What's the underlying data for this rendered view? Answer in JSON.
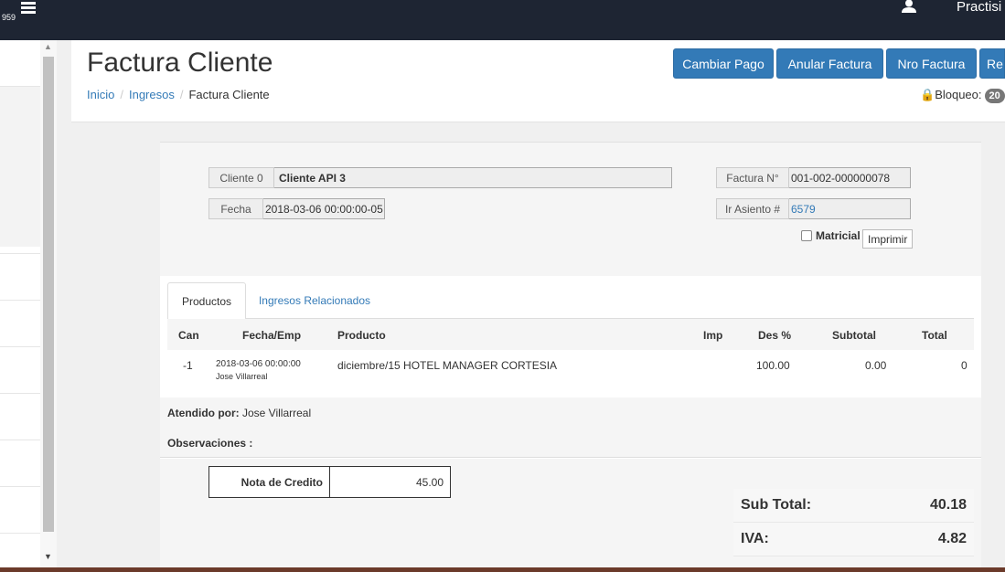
{
  "topbar": {
    "badge": "959",
    "user_name": "Practisi"
  },
  "header": {
    "title": "Factura Cliente",
    "breadcrumb": [
      "Inicio",
      "Ingresos",
      "Factura Cliente"
    ],
    "buttons": {
      "cambiar_pago": "Cambiar Pago",
      "anular_factura": "Anular Factura",
      "nro_factura": "Nro Factura",
      "re": "Re"
    },
    "lock": {
      "label": "Bloqueo:",
      "value": "20"
    }
  },
  "invoice": {
    "cliente_label": "Cliente 0",
    "cliente_value": "Cliente API 3",
    "fecha_label": "Fecha",
    "fecha_value": "2018-03-06 00:00:00-05",
    "factura_label": "Factura N°",
    "factura_value": "001-002-000000078",
    "asiento_label": "Ir Asiento #",
    "asiento_value": "6579",
    "matricial_label": "Matricial",
    "imprimir_label": "Imprimir"
  },
  "tabs": [
    "Productos",
    "Ingresos Relacionados"
  ],
  "table": {
    "headers": [
      "Can",
      "Fecha/Emp",
      "Producto",
      "Imp",
      "Des %",
      "Subtotal",
      "Total"
    ],
    "rows": [
      {
        "can": "-1",
        "fecha": "2018-03-06 00:00:00",
        "emp": "Jose Villarreal",
        "producto": "diciembre/15 HOTEL MANAGER CORTESIA",
        "imp": "",
        "des": "100.00",
        "subtotal": "0.00",
        "total": "0"
      }
    ]
  },
  "atendido": {
    "label": "Atendido por:",
    "value": "Jose Villarreal"
  },
  "observaciones": {
    "label": "Observaciones :"
  },
  "nota_credito": {
    "label": "Nota de Credito",
    "value": "45.00"
  },
  "totals": [
    {
      "label": "Sub Total:",
      "value": "40.18"
    },
    {
      "label": "IVA:",
      "value": "4.82"
    }
  ]
}
